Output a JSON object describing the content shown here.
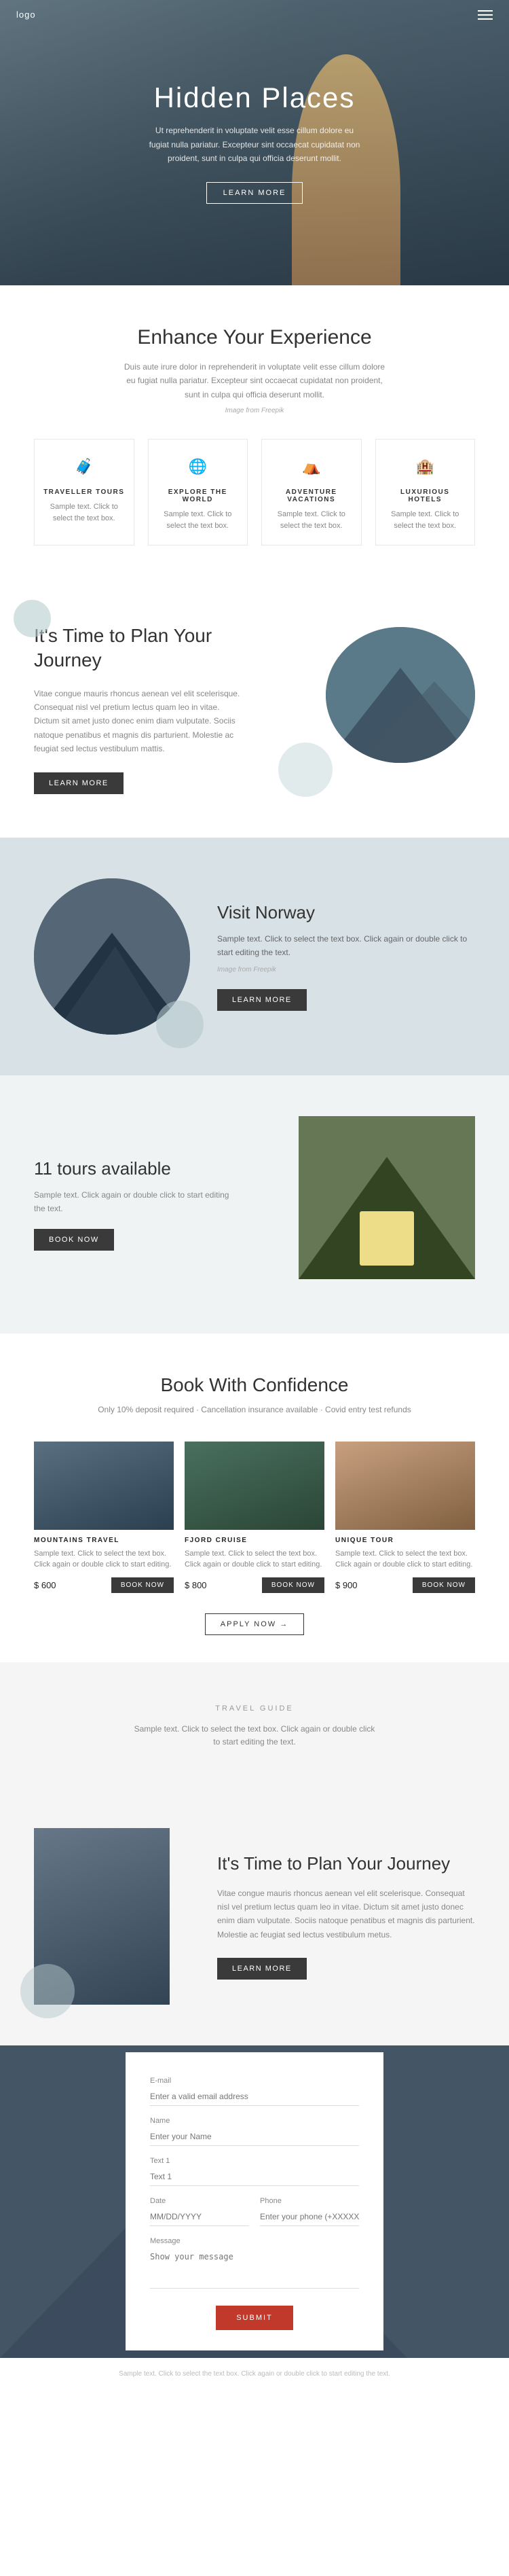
{
  "header": {
    "logo": "logo"
  },
  "hero": {
    "title": "Hidden Places",
    "description": "Ut reprehenderit in voluptate velit esse cillum dolore eu fugiat nulla pariatur. Excepteur sint occaecat cupidatat non proident, sunt in culpa qui officia deserunt mollit.",
    "cta_label": "LEARN MORE"
  },
  "enhance": {
    "title": "Enhance Your Experience",
    "description": "Duis aute irure dolor in reprehenderit in voluptate velit esse cillum dolore eu fugiat nulla pariatur. Excepteur sint occaecat cupidatat non proident, sunt in culpa qui officia deserunt mollit.",
    "img_credit": "Image from Freepik",
    "features": [
      {
        "icon": "🧳",
        "title": "TRAVELLER TOURS",
        "description": "Sample text. Click to select the text box."
      },
      {
        "icon": "🌐",
        "title": "EXPLORE THE WORLD",
        "description": "Sample text. Click to select the text box."
      },
      {
        "icon": "⛺",
        "title": "ADVENTURE VACATIONS",
        "description": "Sample text. Click to select the text box."
      },
      {
        "icon": "🏨",
        "title": "LUXURIOUS HOTELS",
        "description": "Sample text. Click to select the text box."
      }
    ]
  },
  "plan_journey_1": {
    "title": "It's Time to Plan Your Journey",
    "description": "Vitae congue mauris rhoncus aenean vel elit scelerisque. Consequat nisl vel pretium lectus quam leo in vitae. Dictum sit amet justo donec enim diam vulputate. Sociis natoque penatibus et magnis dis parturient. Molestie ac feugiat sed lectus vestibulum mattis.",
    "cta_label": "LEARN MORE"
  },
  "visit_norway": {
    "title": "Visit Norway",
    "description": "Sample text. Click to select the text box. Click again or double click to start editing the text.",
    "img_credit": "Image from Freepik",
    "cta_label": "LEARN MORE"
  },
  "tours_available": {
    "count": "11 tours available",
    "description": "Sample text. Click again or double click to start editing the text.",
    "cta_label": "BOOK NOW"
  },
  "book_confidence": {
    "title": "Book With Confidence",
    "description": "Only 10% deposit required · Cancellation insurance available · Covid entry test refunds",
    "tours": [
      {
        "name": "MOUNTAINS TRAVEL",
        "description": "Sample text. Click to select the text box. Click again or double click to start editing.",
        "price": "$ 600",
        "btn_label": "BOOK NOW"
      },
      {
        "name": "FJORD CRUISE",
        "description": "Sample text. Click to select the text box. Click again or double click to start editing.",
        "price": "$ 800",
        "btn_label": "BOOK NOW"
      },
      {
        "name": "UNIQUE TOUR",
        "description": "Sample text. Click to select the text box. Click again or double click to start editing.",
        "price": "$ 900",
        "btn_label": "BOOK NOW"
      }
    ],
    "apply_label": "APPLY NOW →"
  },
  "travel_guide": {
    "label": "TRAVEL GUIDE",
    "description": "Sample text. Click to select the text box. Click again or double click to start editing the text."
  },
  "plan_journey_2": {
    "title": "It's Time to Plan Your Journey",
    "description": "Vitae congue mauris rhoncus aenean vel elit scelerisque. Consequat nisl vel pretium lectus quam leo in vitae. Dictum sit amet justo donec enim diam vulputate. Sociis natoque penatibus et magnis dis parturient. Molestie ac feugiat sed lectus vestibulum metus.",
    "cta_label": "LEARN MORE"
  },
  "contact": {
    "fields": {
      "email_label": "E-mail",
      "email_placeholder": "Enter a valid email address",
      "name_label": "Name",
      "name_placeholder": "Enter your Name",
      "text1_label": "Text 1",
      "text1_placeholder": "Text 1",
      "date_label": "Date",
      "date_placeholder": "MM/DD/YYYY",
      "phone_label": "Phone",
      "phone_placeholder": "Enter your phone (+XXXXXXXXXX)",
      "message_label": "Message",
      "message_placeholder": "Show your message"
    },
    "submit_label": "SUBMIT"
  },
  "footer": {
    "text": "Sample text. Click to select the text box. Click again or double click to start editing the text."
  }
}
